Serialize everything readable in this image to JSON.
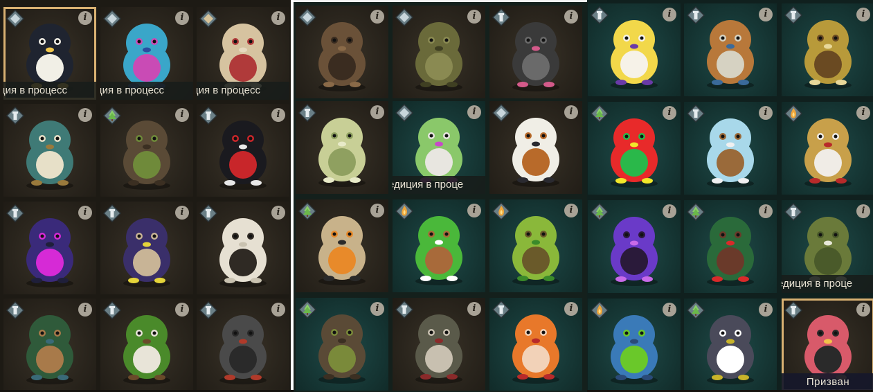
{
  "statuses": {
    "expedition": "ция в процесс",
    "expedition_b": "едиция в проце",
    "summoned": "Призван"
  },
  "colors": {
    "selected_border": "#d9b172",
    "brown_card": "#2a251d",
    "teal_card": "#163735",
    "info_badge": "#a8a296"
  },
  "info_glyph": "i",
  "panels": [
    {
      "name": "panel-left",
      "cards": [
        {
          "plush": "penguin",
          "rank": "diamond",
          "status": "expedition",
          "selected": true
        },
        {
          "plush": "blue-penguin",
          "rank": "diamond",
          "status": "expedition"
        },
        {
          "plush": "fox-plush",
          "rank": "sand-diamond",
          "status": "expedition"
        },
        {
          "plush": "diver-plush",
          "rank": "tower",
          "status": ""
        },
        {
          "plush": "stump-plush",
          "rank": "tree",
          "status": ""
        },
        {
          "plush": "black-red-rabbit",
          "rank": "tower",
          "status": ""
        },
        {
          "plush": "purple-bat",
          "rank": "tower",
          "status": ""
        },
        {
          "plush": "cat-bat",
          "rank": "tower",
          "status": ""
        },
        {
          "plush": "white-ghost",
          "rank": "tower",
          "status": ""
        },
        {
          "plush": "hooded-archer",
          "rank": "tower",
          "status": ""
        },
        {
          "plush": "green-viking",
          "rank": "tower",
          "status": ""
        },
        {
          "plush": "chain-robot",
          "rank": "tower",
          "status": ""
        }
      ]
    },
    {
      "name": "panel-middle",
      "cards": [
        {
          "plush": "moth-plush",
          "rank": "diamond",
          "status": ""
        },
        {
          "plush": "tree-golem",
          "rank": "diamond",
          "status": ""
        },
        {
          "plush": "octopus-knit",
          "rank": "tower",
          "status": ""
        },
        {
          "plush": "jellyfish-plush",
          "rank": "tower",
          "status": ""
        },
        {
          "plush": "green-penguin",
          "rank": "diamond",
          "status": "expedition_b"
        },
        {
          "plush": "pilot-penguin",
          "rank": "diamond",
          "status": ""
        },
        {
          "plush": "horned-doll",
          "rank": "tree",
          "status": ""
        },
        {
          "plush": "green-monster",
          "rank": "flame",
          "status": ""
        },
        {
          "plush": "sprout-seed",
          "rank": "flame",
          "status": ""
        },
        {
          "plush": "mushroom-stump",
          "rank": "tree",
          "status": ""
        },
        {
          "plush": "knight-plush",
          "rank": "tower",
          "status": ""
        },
        {
          "plush": "orange-devil",
          "rank": "tower",
          "status": ""
        }
      ]
    },
    {
      "name": "panel-right",
      "cards": [
        {
          "plush": "egg-chick",
          "rank": "tower",
          "status": ""
        },
        {
          "plush": "hood-doll",
          "rank": "tower",
          "status": ""
        },
        {
          "plush": "antler-pig",
          "rank": "tower",
          "status": ""
        },
        {
          "plush": "rainbow-afro",
          "rank": "tree",
          "status": ""
        },
        {
          "plush": "ghost-witch",
          "rank": "tower",
          "status": ""
        },
        {
          "plush": "winged-knight",
          "rank": "flame",
          "status": ""
        },
        {
          "plush": "purple-vampire",
          "rank": "tree",
          "status": ""
        },
        {
          "plush": "christmas-tree",
          "rank": "tree",
          "status": ""
        },
        {
          "plush": "green-blob",
          "rank": "tower",
          "status": "expedition_b"
        },
        {
          "plush": "blue-sprout",
          "rank": "flame",
          "status": ""
        },
        {
          "plush": "gray-monster",
          "rank": "tree",
          "status": ""
        },
        {
          "plush": "pink-horned",
          "rank": "tower",
          "status": "summoned",
          "selected": true
        }
      ]
    }
  ]
}
